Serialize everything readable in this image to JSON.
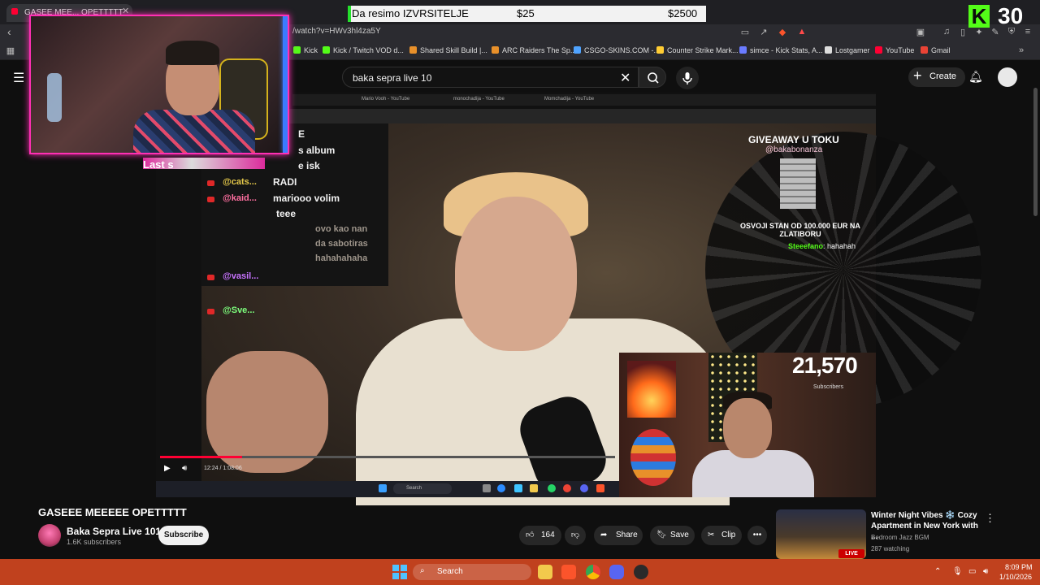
{
  "browser": {
    "tab_title": "GASEE MEE... OPETTTTT",
    "url": "/watch?v=HWv3hl4za5Y",
    "bookmarks": [
      {
        "label": "Kick",
        "color": "#53fc18"
      },
      {
        "label": "Kick / Twitch VOD d...",
        "color": "#53fc18"
      },
      {
        "label": "Shared Skill Build |...",
        "color": "#e8902a"
      },
      {
        "label": "ARC Raiders The Sp...",
        "color": "#e8902a"
      },
      {
        "label": "CSGO-SKINS.COM -...",
        "color": "#4fa3ff"
      },
      {
        "label": "Counter Strike Mark...",
        "color": "#ffcc33"
      },
      {
        "label": "simce - Kick Stats, A...",
        "color": "#6a7bff"
      },
      {
        "label": "Lostgamer",
        "color": "#dddddd"
      },
      {
        "label": "YouTube",
        "color": "#ff0033"
      },
      {
        "label": "Gmail",
        "color": "#ea4335"
      }
    ]
  },
  "overlay": {
    "donation_label": "Da resimo IZVRSITELJE",
    "donation_amount": "$25",
    "donation_goal": "$2500",
    "donation_progress": 0.01,
    "kick_letter": "K",
    "kick_viewers": "30",
    "last_label": "Last s",
    "accent_pink": "#ff2fb4",
    "kick_green": "#53fc18"
  },
  "youtube": {
    "search_query": "baka sepra live 10",
    "create_label": "Create",
    "video_title": "GASEEE MEEEEE OPETTTTT",
    "channel_name": "Baka Sepra Live 101",
    "channel_subs": "1.6K subscribers",
    "subscribe_label": "Subscribe",
    "like_count": "164",
    "share_label": "Share",
    "save_label": "Save",
    "clip_label": "Clip"
  },
  "video_content": {
    "inner_tabs": [
      "Mario Vooh - YouTube",
      "monochadija - YouTube",
      "Momchadija - YouTube"
    ],
    "chat": [
      {
        "user": "",
        "msg": "E"
      },
      {
        "user": "",
        "msg": "s album"
      },
      {
        "user": "",
        "msg": "e isk"
      },
      {
        "user": "@cats...",
        "msg": "RADI",
        "color": "#e6c94a"
      },
      {
        "user": "@kaid...",
        "msg": "mariooo volim",
        "color": "#ff6fa0"
      },
      {
        "user": "",
        "msg": "teee"
      },
      {
        "user": "@vasil...",
        "msg": "",
        "color": "#c873ff"
      },
      {
        "user": "@Sve...",
        "msg": "",
        "color": "#7dff7d"
      }
    ],
    "faded_msgs": [
      "ovo kao nan",
      "da sabotiras",
      "hahahahaha"
    ],
    "giveaway_title": "GIVEAWAY U TOKU",
    "giveaway_handle": "@bakabonanza",
    "giveaway_prize": "OSVOJI STAN OD 100.000 EUR NA ZLATIBORU",
    "kick_chat_user": "Steeefano",
    "kick_chat_msg": ": hahahah",
    "sub_count": "21,570",
    "sub_label": "Subscribers",
    "inner_time": "12:24 / 1:08:06",
    "inner_progress": 0.18,
    "inner_search": "Search"
  },
  "recommendation": {
    "title": "Winter Night Vibes ❄️ Cozy Apartment in New York with ...",
    "channel": "Bedroom Jazz BGM",
    "watching": "287 watching",
    "live_badge": "LIVE"
  },
  "taskbar": {
    "search_label": "Search",
    "time": "8:09 PM",
    "date": "1/10/2026",
    "color": "#c0411e"
  }
}
